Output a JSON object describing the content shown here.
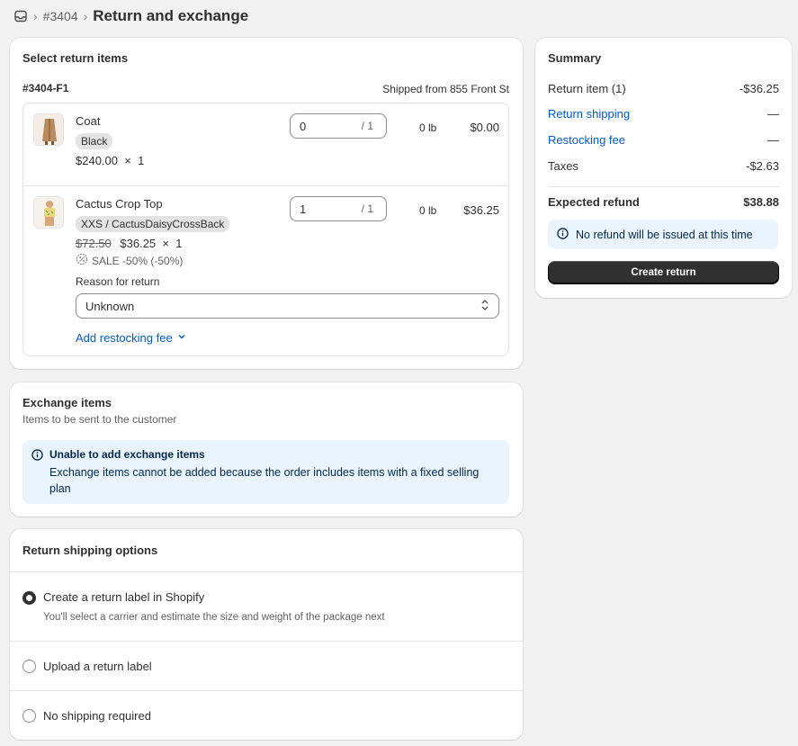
{
  "breadcrumb": {
    "order": "#3404",
    "title": "Return and exchange"
  },
  "select_items": {
    "title": "Select return items",
    "fulfillment_id": "#3404-F1",
    "shipped_from": "Shipped from 855 Front St",
    "items": [
      {
        "name": "Coat",
        "variant": "Black",
        "price": "$240.00",
        "times": "×",
        "quantity": "1",
        "return_qty": "0",
        "max_qty": "/ 1",
        "weight": "0 lb",
        "total": "$0.00"
      },
      {
        "name": "Cactus Crop Top",
        "variant": "XXS / CactusDaisyCrossBack",
        "original_price": "$72.50",
        "price": "$36.25",
        "times": "×",
        "quantity": "1",
        "discount": "SALE -50% (-50%)",
        "return_qty": "1",
        "max_qty": "/ 1",
        "weight": "0 lb",
        "total": "$36.25",
        "reason_label": "Reason for return",
        "reason_value": "Unknown",
        "restocking_link": "Add restocking fee"
      }
    ]
  },
  "exchange": {
    "title": "Exchange items",
    "subtitle": "Items to be sent to the customer",
    "banner_title": "Unable to add exchange items",
    "banner_text": "Exchange items cannot be added because the order includes items with a fixed selling plan"
  },
  "shipping": {
    "title": "Return shipping options",
    "options": [
      {
        "label": "Create a return label in Shopify",
        "help": "You'll select a carrier and estimate the size and weight of the package next",
        "selected": true
      },
      {
        "label": "Upload a return label",
        "selected": false
      },
      {
        "label": "No shipping required",
        "selected": false
      }
    ]
  },
  "summary": {
    "title": "Summary",
    "return_item_label": "Return item (1)",
    "return_item_value": "-$36.25",
    "return_shipping_label": "Return shipping",
    "return_shipping_value": "—",
    "restocking_label": "Restocking fee",
    "restocking_value": "—",
    "taxes_label": "Taxes",
    "taxes_value": "-$2.63",
    "expected_refund_label": "Expected refund",
    "expected_refund_value": "$38.88",
    "info_text": "No refund will be issued at this time",
    "create_button": "Create return"
  },
  "colors": {
    "link": "#005bd3",
    "primary_button": "#303030",
    "info_bg": "#eaf4ff"
  },
  "icons": [
    "inbox-icon",
    "chevron-right-icon",
    "info-icon",
    "discount-icon",
    "chevron-down-icon",
    "select-arrows-icon"
  ]
}
